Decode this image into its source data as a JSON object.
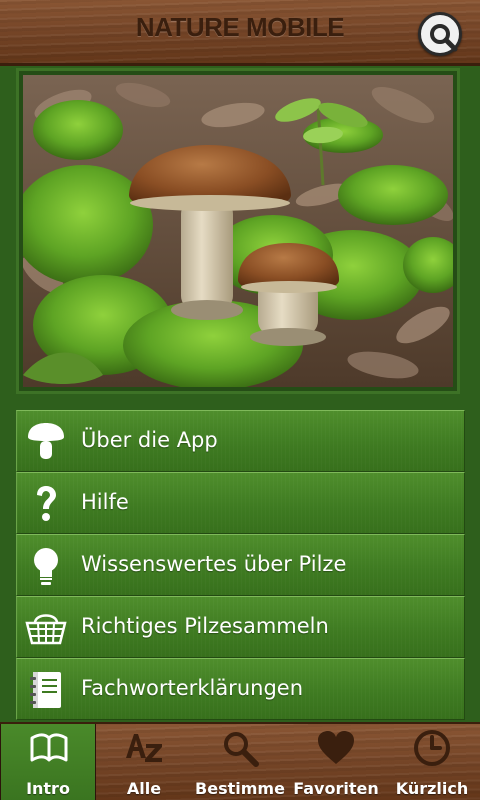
{
  "header": {
    "brand": "NATURE MOBILE",
    "search_icon": "magnifier-icon"
  },
  "hero": {
    "subject": "porcini-mushrooms-photo"
  },
  "menu": {
    "items": [
      {
        "label": "Über die App",
        "icon": "mushroom-icon"
      },
      {
        "label": "Hilfe",
        "icon": "question-mark-icon"
      },
      {
        "label": "Wissenswertes über Pilze",
        "icon": "lightbulb-icon"
      },
      {
        "label": "Richtiges Pilzesammeln",
        "icon": "basket-icon"
      },
      {
        "label": "Fachworterklärungen",
        "icon": "notebook-icon"
      }
    ]
  },
  "tabs": [
    {
      "label": "Intro",
      "icon": "open-book-icon",
      "active": true
    },
    {
      "label": "Alle",
      "icon": "a-z-icon",
      "active": false
    },
    {
      "label": "Bestimme",
      "icon": "magnifier-icon",
      "active": false
    },
    {
      "label": "Favoriten",
      "icon": "heart-icon",
      "active": false
    },
    {
      "label": "Kürzlich",
      "icon": "clock-icon",
      "active": false
    }
  ],
  "colors": {
    "wood": "#754527",
    "wood_dark": "#3a1f0c",
    "green": "#3e7a21",
    "green_light": "#4f8e2c",
    "text": "#ffffff"
  }
}
